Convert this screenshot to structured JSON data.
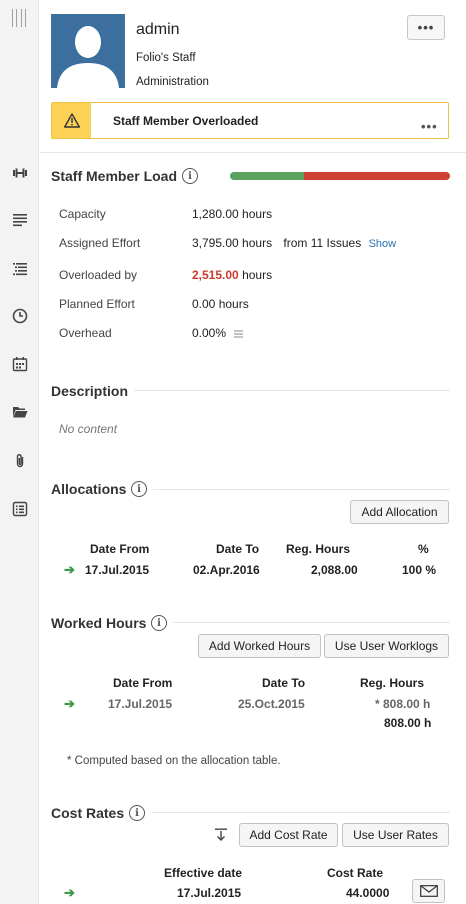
{
  "header": {
    "name": "admin",
    "line1": "Folio's Staff",
    "line2": "Administration",
    "more": "•••"
  },
  "warning": {
    "text": "Staff Member Overloaded",
    "dots": "•••"
  },
  "load": {
    "title": "Staff Member Load",
    "assigned_fraction": 0.337,
    "capacity_label": "Capacity",
    "capacity_value": "1,280.00 hours",
    "assigned_label": "Assigned Effort",
    "assigned_value": "3,795.00 hours",
    "assigned_from": "from 11 Issues",
    "assigned_link": "Show",
    "overloaded_label": "Overloaded by",
    "overloaded_value": "2,515.00",
    "overloaded_unit": "hours",
    "planned_label": "Planned Effort",
    "planned_value": "0.00 hours",
    "overhead_label": "Overhead",
    "overhead_value": "0.00%"
  },
  "description": {
    "title": "Description",
    "empty": "No content"
  },
  "allocations": {
    "title": "Allocations",
    "add_button": "Add Allocation",
    "columns": [
      "Date From",
      "Date To",
      "Reg. Hours",
      "%"
    ],
    "rows": [
      {
        "from": "17.Jul.2015",
        "to": "02.Apr.2016",
        "hours": "2,088.00",
        "pct": "100 %"
      }
    ]
  },
  "worked": {
    "title": "Worked Hours",
    "add_button": "Add Worked Hours",
    "worklogs_button": "Use User Worklogs",
    "columns": [
      "Date From",
      "Date To",
      "Reg. Hours"
    ],
    "rows": [
      {
        "from": "17.Jul.2015",
        "to": "25.Oct.2015",
        "hours": "* 808.00 h"
      }
    ],
    "total": "808.00 h",
    "note": "* Computed based on the allocation table."
  },
  "cost": {
    "title": "Cost Rates",
    "add_button": "Add Cost Rate",
    "user_button": "Use User Rates",
    "columns": [
      "Effective date",
      "Cost Rate"
    ],
    "rows": [
      {
        "date": "17.Jul.2015",
        "rate": "44.0000"
      }
    ]
  },
  "colors": {
    "load_ok": "#59a35c",
    "load_over": "#cc4233",
    "warning": "#fbd156",
    "overloaded_text": "#cc3b2d"
  }
}
